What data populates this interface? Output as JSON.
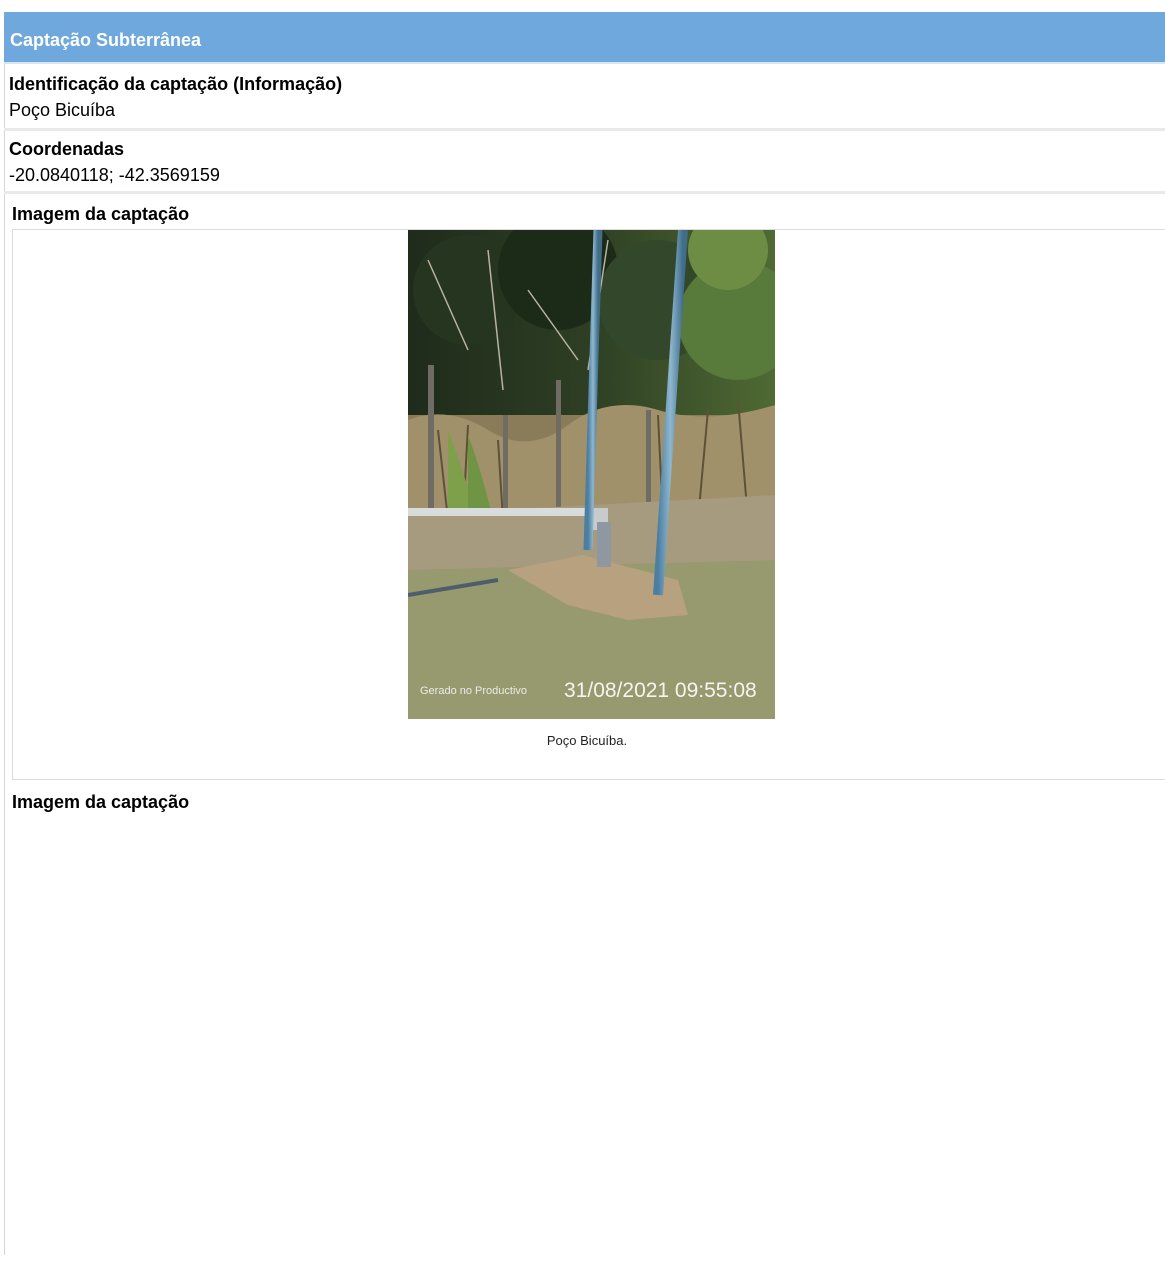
{
  "section": {
    "title": "Captação Subterrânea"
  },
  "identification": {
    "label": "Identificação da captação (Informação)",
    "value": "Poço Bicuíba"
  },
  "coordinates": {
    "label": "Coordenadas",
    "value": "-20.0840118; -42.3569159"
  },
  "images": [
    {
      "label": "Imagem da captação",
      "caption": "Poço Bicuíba.",
      "overlay_brand": "Gerado no Productivo",
      "overlay_timestamp": "31/08/2021 09:55:08"
    },
    {
      "label": "Imagem da captação"
    }
  ],
  "colors": {
    "header_bg": "#6fa8dc",
    "header_text": "#ffffff"
  }
}
